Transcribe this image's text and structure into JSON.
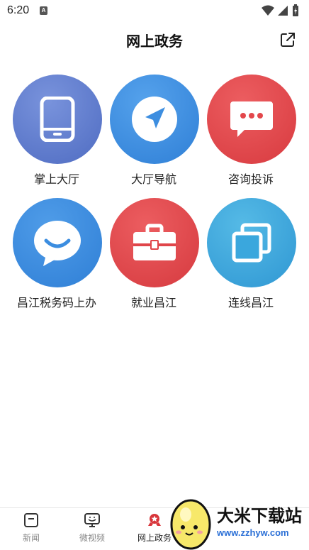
{
  "status_bar": {
    "time": "6:20",
    "notification_icon": "a-icon",
    "icons": [
      "wifi-icon",
      "signal-icon",
      "battery-icon"
    ]
  },
  "header": {
    "title": "网上政务",
    "share_icon": "share-icon"
  },
  "tiles": [
    {
      "label": "掌上大厅",
      "icon": "phone-icon",
      "color": "#5c7bcc"
    },
    {
      "label": "大厅导航",
      "icon": "navigation-icon",
      "color": "#3d8ee0"
    },
    {
      "label": "咨询投诉",
      "icon": "chat-dots-icon",
      "color": "#e3474b"
    },
    {
      "label": "昌江税务码上办",
      "icon": "chat-smile-icon",
      "color": "#3b8de0"
    },
    {
      "label": "就业昌江",
      "icon": "toolbox-icon",
      "color": "#e0454a"
    },
    {
      "label": "连线昌江",
      "icon": "copy-windows-icon",
      "color": "#3aa7dd"
    }
  ],
  "tabbar": {
    "tabs": [
      {
        "label": "新闻",
        "icon": "news-icon"
      },
      {
        "label": "微视频",
        "icon": "video-icon"
      },
      {
        "label": "网上政务",
        "icon": "badge-icon",
        "active": true
      }
    ]
  },
  "watermark": {
    "title": "大米下载站",
    "url": "www.zzhyw.com",
    "logo": "rice-mascot-icon"
  }
}
